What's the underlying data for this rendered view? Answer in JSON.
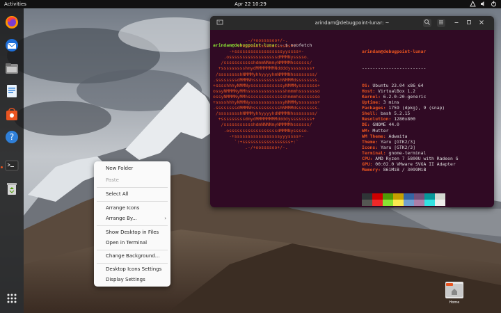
{
  "topbar": {
    "activities": "Activities",
    "clock": "Apr 22  10:29",
    "tray_icons": [
      "network-icon",
      "volume-icon",
      "power-icon"
    ]
  },
  "dock": {
    "apps": [
      "firefox-icon",
      "thunderbird-icon",
      "files-icon",
      "writer-icon",
      "software-icon",
      "help-icon",
      "terminal-icon",
      "trash-icon",
      "app-grid-icon"
    ]
  },
  "terminal": {
    "title": "arindam@debugpoint-lunar: ~",
    "prompt_user": "arindam@debugpoint-lunar",
    "prompt_path": ":~",
    "prompt_cmd": "$ neofetch",
    "logo": "            .-/+oossssoo+/-.\n        `:+ssssssssssssssssss+:`\n      -+ssssssssssssssssssyyssss+-\n    .ossssssssssssssssssdMMMNysssso.\n   /ssssssssssshdmmNNmmyNMMMMhssssss/\n  +ssssssssshmydMMMMMMMNddddyssssssss+\n /sssssssshNMMMyhhyyyyhmNMMMNhssssssss/\n.ssssssssdMMMNhsssssssssshNMMMdssssssss.\n+sssshhhyNMMNyssssssssssssyNMMMysssssss+\nossyNMMMNyMMhsssssssssssssshmmmhssssssso\nossyNMMMNyMMhsssssssssssssshmmmhssssssso\n+sssshhhyNMMNyssssssssssssyNMMMysssssss+\n.ssssssssdMMMNhsssssssssshNMMMdssssssss.\n /sssssssshNMMMyhhyyyyhdNMMMNhssssssss/\n  +sssssssssdmydMMMMMMMMddddyssssssss+\n   /ssssssssssshdmNNNNmyNMMMMhssssss/\n    .ossssssssssssssssssdMMMNysssso.\n      -+sssssssssssssssssyyyssss+-\n        `:+ssssssssssssssssss+:`\n            .-/+oossssoo+/-.",
    "user_host": "arindam@debugpoint-lunar",
    "separator": "------------------------",
    "info": [
      {
        "key": "OS",
        "value": "Ubuntu 23.04 x86_64"
      },
      {
        "key": "Host",
        "value": "VirtualBox 1.2"
      },
      {
        "key": "Kernel",
        "value": "6.2.0-20-generic"
      },
      {
        "key": "Uptime",
        "value": "3 mins"
      },
      {
        "key": "Packages",
        "value": "1759 (dpkg), 9 (snap)"
      },
      {
        "key": "Shell",
        "value": "bash 5.2.15"
      },
      {
        "key": "Resolution",
        "value": "1280x800"
      },
      {
        "key": "DE",
        "value": "GNOME 44.0"
      },
      {
        "key": "WM",
        "value": "Mutter"
      },
      {
        "key": "WM Theme",
        "value": "Adwaita"
      },
      {
        "key": "Theme",
        "value": "Yaru [GTK2/3]"
      },
      {
        "key": "Icons",
        "value": "Yaru [GTK2/3]"
      },
      {
        "key": "Terminal",
        "value": "gnome-terminal"
      },
      {
        "key": "CPU",
        "value": "AMD Ryzen 7 5800U with Radeon G"
      },
      {
        "key": "GPU",
        "value": "00:02.0 VMware SVGA II Adapter"
      },
      {
        "key": "Memory",
        "value": "861MiB / 3099MiB"
      }
    ],
    "palette_row1": [
      "#2e3436",
      "#cc0000",
      "#4e9a06",
      "#c4a000",
      "#3465a4",
      "#75507b",
      "#06989a",
      "#d3d7cf"
    ],
    "palette_row2": [
      "#555753",
      "#ef2929",
      "#8ae234",
      "#fce94f",
      "#729fcf",
      "#ad7fa8",
      "#34e2e2",
      "#eeeeec"
    ]
  },
  "context_menu": {
    "items": [
      {
        "label": "New Folder",
        "enabled": true
      },
      {
        "label": "Paste",
        "enabled": false
      },
      {
        "label": "Select All",
        "enabled": true
      },
      {
        "label": "Arrange Icons",
        "enabled": true
      },
      {
        "label": "Arrange By...",
        "enabled": true,
        "submenu": true
      },
      {
        "label": "Show Desktop in Files",
        "enabled": true
      },
      {
        "label": "Open in Terminal",
        "enabled": true
      },
      {
        "label": "Change Background...",
        "enabled": true
      },
      {
        "label": "Desktop Icons Settings",
        "enabled": true
      },
      {
        "label": "Display Settings",
        "enabled": true
      }
    ]
  },
  "desktop": {
    "home_label": "Home"
  },
  "colors": {
    "accent": "#e95420",
    "terminal_bg": "#300a24"
  }
}
